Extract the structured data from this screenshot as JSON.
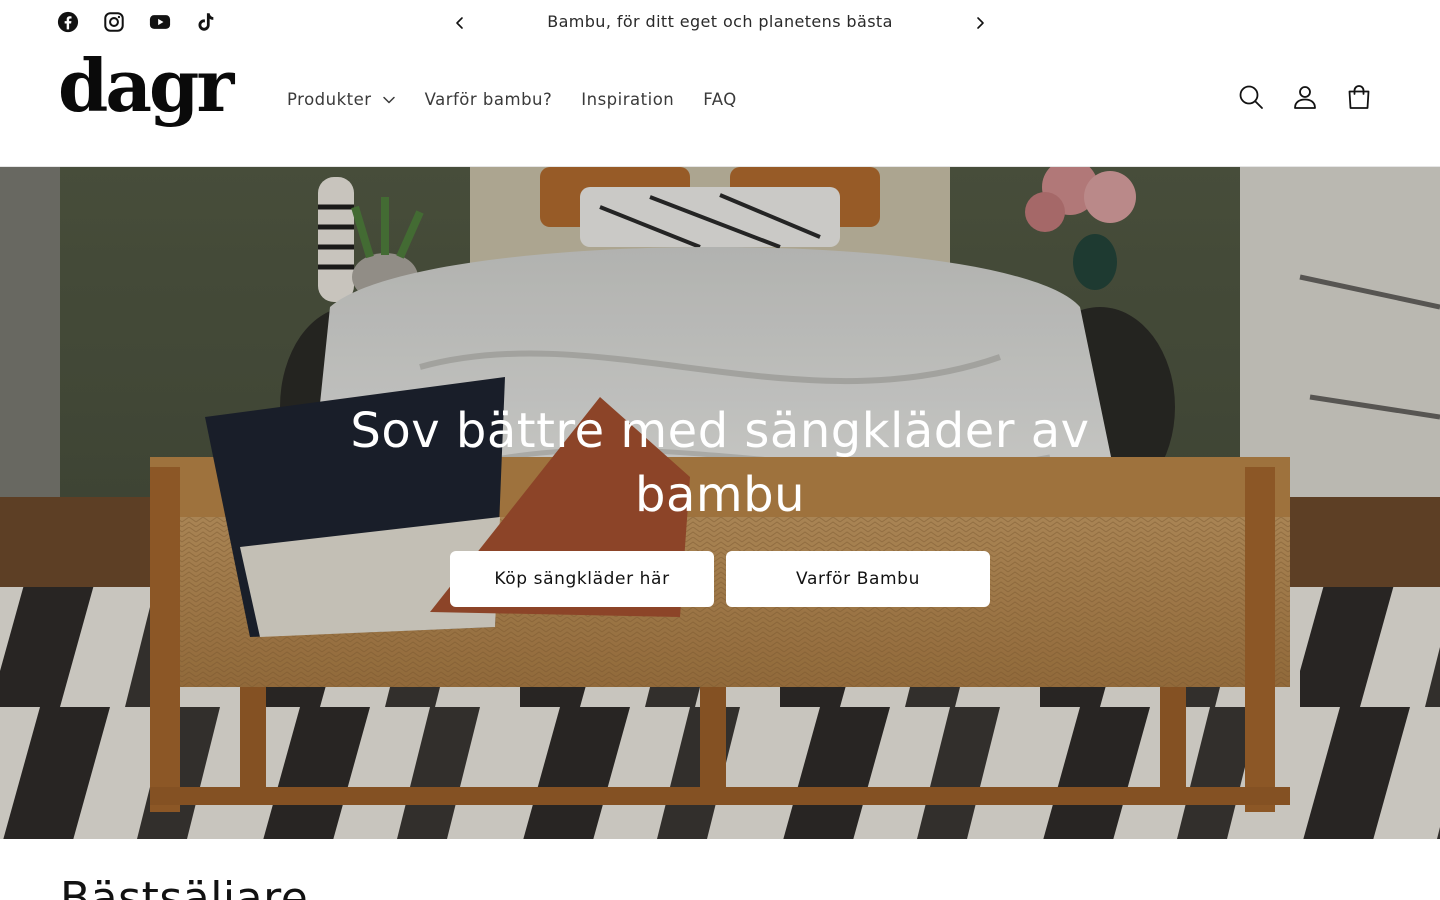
{
  "announcement": {
    "social": [
      {
        "name": "facebook-icon"
      },
      {
        "name": "instagram-icon"
      },
      {
        "name": "youtube-icon"
      },
      {
        "name": "tiktok-icon"
      }
    ],
    "text": "Bambu, för ditt eget och planetens bästa",
    "prev_icon": "chevron-left-icon",
    "next_icon": "chevron-right-icon"
  },
  "header": {
    "logo": "dagr",
    "nav": [
      {
        "label": "Produkter",
        "has_dropdown": true
      },
      {
        "label": "Varför bambu?"
      },
      {
        "label": "Inspiration"
      },
      {
        "label": "FAQ"
      }
    ],
    "icons": [
      "search-icon",
      "account-icon",
      "cart-icon"
    ]
  },
  "hero": {
    "title": "Sov bättre med sängkläder av bambu",
    "buttons": [
      {
        "label": "Köp sängkläder här"
      },
      {
        "label": "Varför Bambu"
      }
    ]
  },
  "next_section": {
    "title": "Bästsäljare"
  },
  "colors": {
    "text": "#121212",
    "background": "#ffffff",
    "button_bg": "#ffffff"
  }
}
